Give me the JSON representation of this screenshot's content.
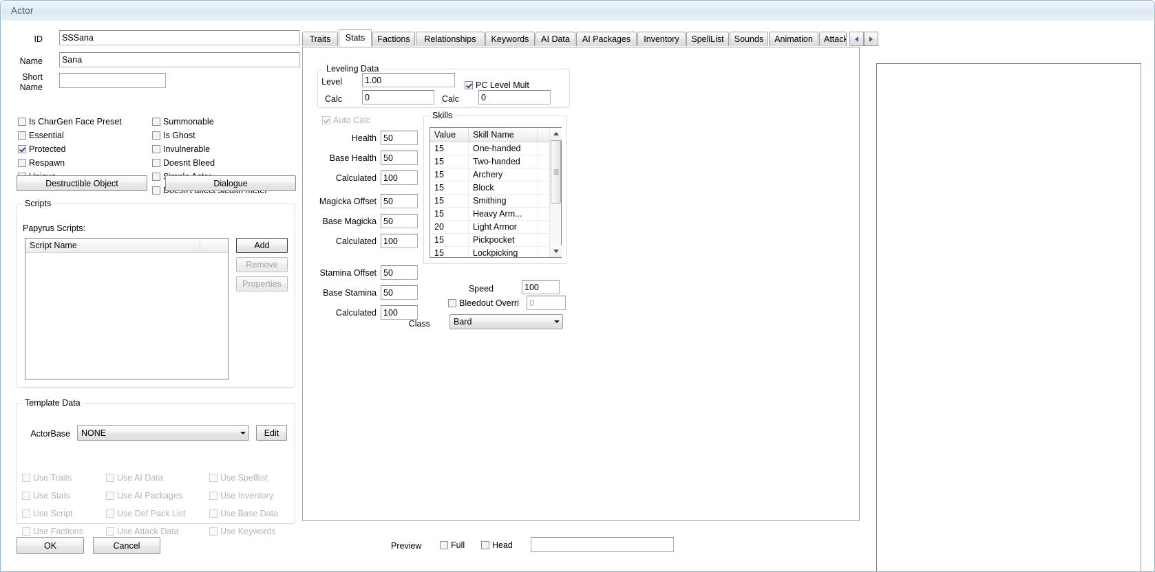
{
  "window": {
    "title": "Actor"
  },
  "identity": {
    "id_label": "ID",
    "id_value": "SSSana",
    "name_label": "Name",
    "name_value": "Sana",
    "short_name_label_line1": "Short",
    "short_name_label_line2": "Name",
    "short_name_value": ""
  },
  "flags_left": [
    {
      "label": "Is CharGen Face Preset",
      "checked": false
    },
    {
      "label": "Essential",
      "checked": false
    },
    {
      "label": "Protected",
      "checked": true
    },
    {
      "label": "Respawn",
      "checked": false
    },
    {
      "label": "Unique",
      "checked": true
    }
  ],
  "flags_right": [
    {
      "label": "Summonable",
      "checked": false
    },
    {
      "label": "Is Ghost",
      "checked": false
    },
    {
      "label": "Invulnerable",
      "checked": false
    },
    {
      "label": "Doesnt Bleed",
      "checked": false
    },
    {
      "label": "Simple Actor",
      "checked": false
    },
    {
      "label": "Doesn't affect stealth meter",
      "checked": false
    }
  ],
  "buttons": {
    "destructible_object": "Destructible Object",
    "dialogue": "Dialogue",
    "ok": "OK",
    "cancel": "Cancel",
    "edit": "Edit",
    "add": "Add",
    "remove": "Remove",
    "properties": "Properties"
  },
  "scripts": {
    "group_caption": "Scripts",
    "papyrus_label": "Papyrus Scripts:",
    "column_header": "Script Name",
    "rows": []
  },
  "template_data": {
    "group_caption": "Template Data",
    "actorbase_label": "ActorBase",
    "actorbase_value": "NONE",
    "checkboxes": [
      {
        "label": "Use Traits",
        "checked": false,
        "disabled": true
      },
      {
        "label": "Use AI Data",
        "checked": false,
        "disabled": true
      },
      {
        "label": "Use Spelllist",
        "checked": false,
        "disabled": true
      },
      {
        "label": "Use Stats",
        "checked": false,
        "disabled": true
      },
      {
        "label": "Use AI Packages",
        "checked": false,
        "disabled": true
      },
      {
        "label": "Use Inventory",
        "checked": false,
        "disabled": true
      },
      {
        "label": "Use Script",
        "checked": false,
        "disabled": true
      },
      {
        "label": "Use Def Pack List",
        "checked": false,
        "disabled": true
      },
      {
        "label": "Use Base Data",
        "checked": false,
        "disabled": true
      },
      {
        "label": "Use Factions",
        "checked": false,
        "disabled": true
      },
      {
        "label": "Use Attack Data",
        "checked": false,
        "disabled": true
      },
      {
        "label": "Use Keywords",
        "checked": false,
        "disabled": true
      }
    ]
  },
  "tabs": {
    "selected": "Stats",
    "items": [
      {
        "label": "Traits"
      },
      {
        "label": "Stats"
      },
      {
        "label": "Factions"
      },
      {
        "label": "Relationships"
      },
      {
        "label": "Keywords"
      },
      {
        "label": "AI Data"
      },
      {
        "label": "AI Packages"
      },
      {
        "label": "Inventory"
      },
      {
        "label": "SpellList"
      },
      {
        "label": "Sounds"
      },
      {
        "label": "Animation"
      },
      {
        "label": "Attack Data"
      }
    ],
    "scroll_left_icon": "chevron-left-icon",
    "scroll_right_icon": "chevron-right-icon"
  },
  "leveling": {
    "group_caption": "Leveling Data",
    "level_label": "Level",
    "level_value": "1.00",
    "level_calc_label": "Calc",
    "level_calc_value": "0",
    "pc_level_mult_label": "PC Level Mult",
    "pc_level_mult_checked": true,
    "mult_calc_label": "Calc",
    "mult_calc_value": "0"
  },
  "autocalc": {
    "label": "Auto Calc",
    "checked": true,
    "disabled": true
  },
  "stats": [
    {
      "label": "Health",
      "value": "50"
    },
    {
      "label": "Base Health",
      "value": "50"
    },
    {
      "label": "Calculated",
      "value": "100"
    },
    {
      "label": "Magicka Offset",
      "value": "50"
    },
    {
      "label": "Base Magicka",
      "value": "50"
    },
    {
      "label": "Calculated",
      "value": "100"
    },
    {
      "label": "Stamina Offset",
      "value": "50"
    },
    {
      "label": "Base Stamina",
      "value": "50"
    },
    {
      "label": "Calculated",
      "value": "100"
    }
  ],
  "skills": {
    "group_caption": "Skills",
    "columns": [
      "Value",
      "Skill Name"
    ],
    "rows": [
      {
        "value": "15",
        "name": "One-handed"
      },
      {
        "value": "15",
        "name": "Two-handed"
      },
      {
        "value": "15",
        "name": "Archery"
      },
      {
        "value": "15",
        "name": "Block"
      },
      {
        "value": "15",
        "name": "Smithing"
      },
      {
        "value": "15",
        "name": "Heavy Arm..."
      },
      {
        "value": "20",
        "name": "Light Armor"
      },
      {
        "value": "15",
        "name": "Pickpocket"
      },
      {
        "value": "15",
        "name": "Lockpicking"
      }
    ]
  },
  "misc": {
    "speed_label": "Speed",
    "speed_value": "100",
    "bleedout_label": "Bleedout Overri",
    "bleedout_checked": false,
    "bleedout_value": "0",
    "class_label": "Class",
    "class_value": "Bard"
  },
  "preview": {
    "label": "Preview",
    "full_label": "Full",
    "full_checked": false,
    "head_label": "Head",
    "head_checked": false,
    "field_value": ""
  }
}
